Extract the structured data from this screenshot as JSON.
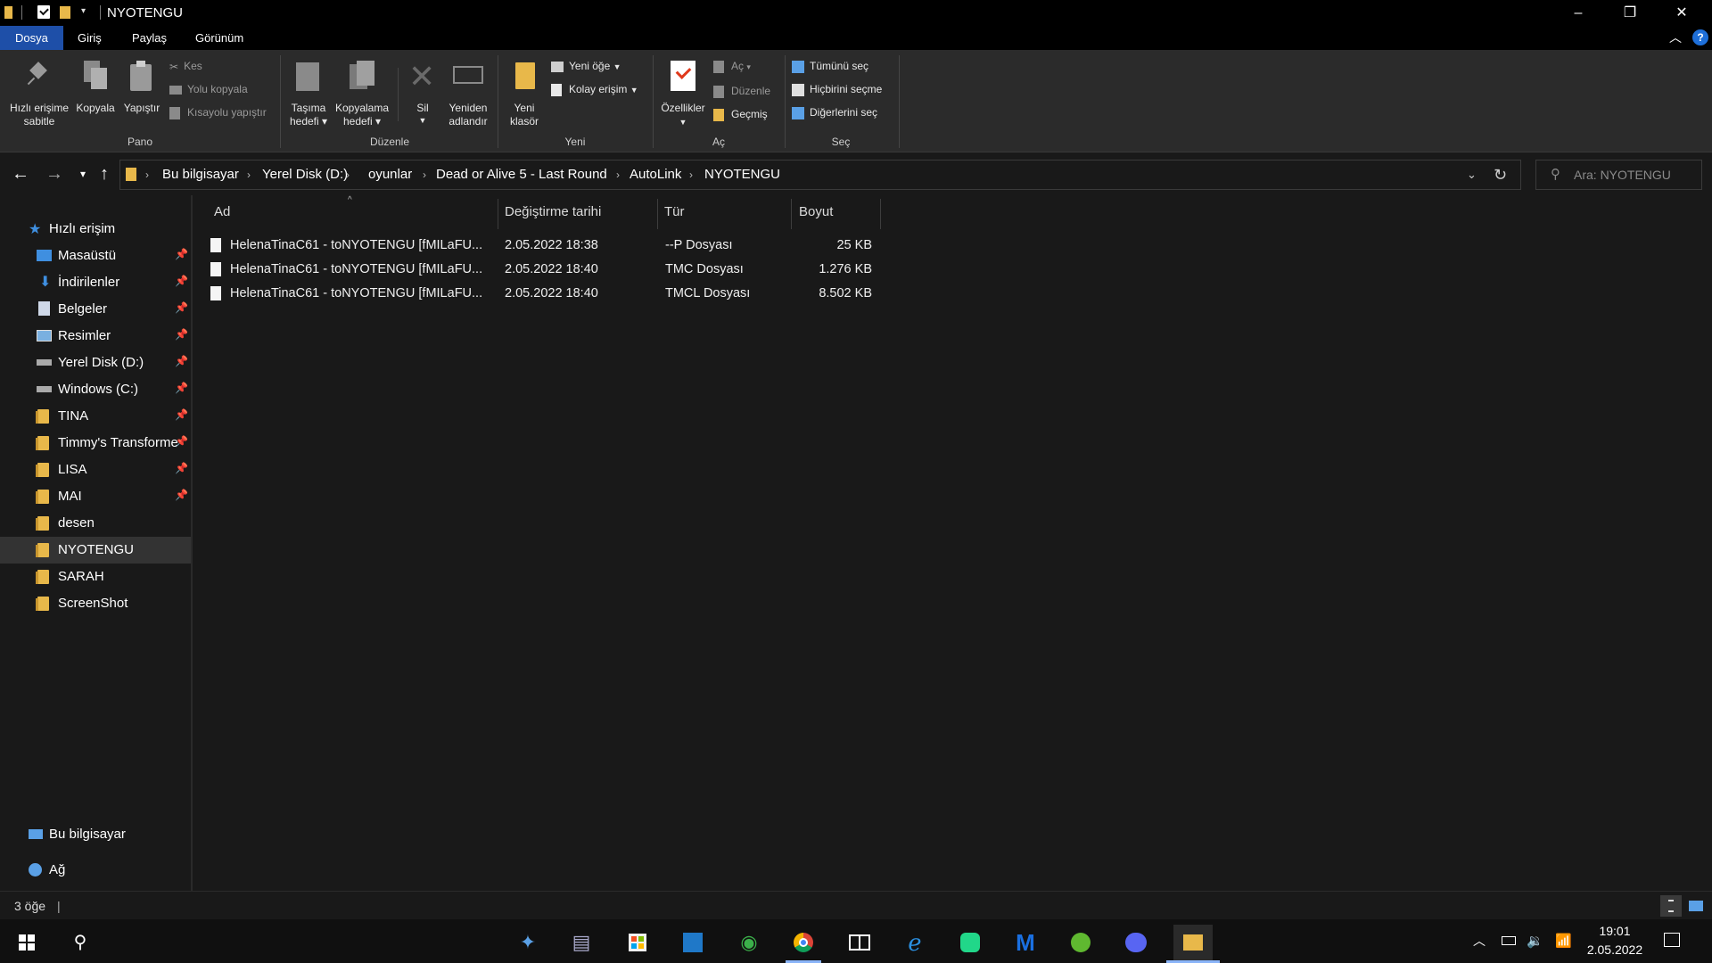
{
  "window": {
    "title": "NYOTENGU"
  },
  "tabs": [
    "Dosya",
    "Giriş",
    "Paylaş",
    "Görünüm"
  ],
  "ribbon": {
    "pano": {
      "group": "Pano",
      "pin_l1": "Hızlı erişime",
      "pin_l2": "sabitle",
      "copy": "Kopyala",
      "paste": "Yapıştır",
      "cut": "Kes",
      "copy_path": "Yolu kopyala",
      "paste_shortcut": "Kısayolu yapıştır"
    },
    "duzenle": {
      "group": "Düzenle",
      "move_l1": "Taşıma",
      "move_l2": "hedefi",
      "copyto_l1": "Kopyalama",
      "copyto_l2": "hedefi",
      "delete": "Sil",
      "rename_l1": "Yeniden",
      "rename_l2": "adlandır"
    },
    "yeni": {
      "group": "Yeni",
      "folder_l1": "Yeni",
      "folder_l2": "klasör",
      "new_item": "Yeni öğe",
      "easy_access": "Kolay erişim"
    },
    "ac": {
      "group": "Aç",
      "properties": "Özellikler",
      "open": "Aç",
      "edit": "Düzenle",
      "history": "Geçmiş"
    },
    "sec": {
      "group": "Seç",
      "select_all": "Tümünü seç",
      "select_none": "Hiçbirini seçme",
      "invert": "Diğerlerini seç"
    }
  },
  "address": {
    "crumbs": [
      "Bu bilgisayar",
      "Yerel Disk (D:)",
      "oyunlar",
      "Dead or Alive 5 - Last Round",
      "AutoLink",
      "NYOTENGU"
    ],
    "search_placeholder": "Ara: NYOTENGU"
  },
  "nav": {
    "quick_access": "Hızlı erişim",
    "items": [
      {
        "label": "Masaüstü",
        "icon": "desktop-icon",
        "pinned": true
      },
      {
        "label": "İndirilenler",
        "icon": "download-icon",
        "pinned": true
      },
      {
        "label": "Belgeler",
        "icon": "documents-icon",
        "pinned": true
      },
      {
        "label": "Resimler",
        "icon": "pictures-icon",
        "pinned": true
      },
      {
        "label": "Yerel Disk (D:)",
        "icon": "drive-icon",
        "pinned": true
      },
      {
        "label": "Windows (C:)",
        "icon": "drive-icon",
        "pinned": true
      },
      {
        "label": "TINA",
        "icon": "folder-icon",
        "pinned": true
      },
      {
        "label": "Timmy's Transforme",
        "icon": "folder-icon",
        "pinned": true
      },
      {
        "label": "LISA",
        "icon": "folder-icon",
        "pinned": true
      },
      {
        "label": "MAI",
        "icon": "folder-icon",
        "pinned": true
      },
      {
        "label": "desen",
        "icon": "folder-icon",
        "pinned": false
      },
      {
        "label": "NYOTENGU",
        "icon": "folder-icon",
        "pinned": false
      },
      {
        "label": "SARAH",
        "icon": "folder-icon",
        "pinned": false
      },
      {
        "label": "ScreenShot",
        "icon": "folder-icon",
        "pinned": false
      }
    ],
    "this_pc": "Bu bilgisayar",
    "network": "Ağ"
  },
  "columns": {
    "name": "Ad",
    "date": "Değiştirme tarihi",
    "type": "Tür",
    "size": "Boyut"
  },
  "files": [
    {
      "name": "HelenaTinaC61 - toNYOTENGU [fMILaFU...",
      "date": "2.05.2022 18:38",
      "type": "--P Dosyası",
      "size": "25 KB"
    },
    {
      "name": "HelenaTinaC61 - toNYOTENGU [fMILaFU...",
      "date": "2.05.2022 18:40",
      "type": "TMC Dosyası",
      "size": "1.276 KB"
    },
    {
      "name": "HelenaTinaC61 - toNYOTENGU [fMILaFU...",
      "date": "2.05.2022 18:40",
      "type": "TMCL Dosyası",
      "size": "8.502 KB"
    }
  ],
  "status": {
    "count": "3 öğe",
    "sep": "|"
  },
  "taskbar": {
    "time": "19:01",
    "date": "2.05.2022"
  },
  "colors": {
    "accent": "#1e4fa8",
    "folder": "#e8b84a",
    "bg": "#191919",
    "ribbon": "#2b2b2b"
  }
}
